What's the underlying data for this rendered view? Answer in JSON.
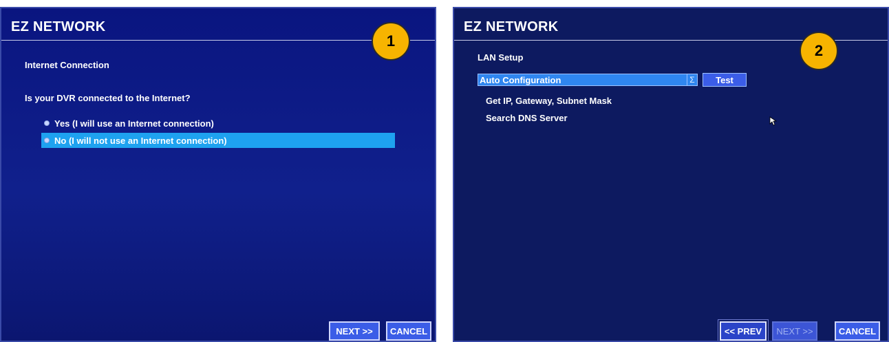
{
  "panel1": {
    "title": "EZ NETWORK",
    "badge": "1",
    "section_label": "Internet Connection",
    "question": "Is your DVR connected to the Internet?",
    "options": [
      {
        "label": "Yes (I will use an Internet connection)",
        "selected": false
      },
      {
        "label": "No (I will not use an Internet connection)",
        "selected": true
      }
    ],
    "next_label": "NEXT >>",
    "cancel_label": "CANCEL"
  },
  "panel2": {
    "title": "EZ NETWORK",
    "badge": "2",
    "section_label": "LAN Setup",
    "dropdown_value": "Auto Configuration",
    "dropdown_arrow": "Σ",
    "test_label": "Test",
    "info_lines": [
      "Get IP, Gateway, Subnet Mask",
      "Search DNS Server"
    ],
    "prev_label": "<< PREV",
    "next_label": "NEXT >>",
    "cancel_label": "CANCEL"
  },
  "colors": {
    "panel_bg": "#0f1a6e",
    "highlight": "#1ea2f0",
    "button": "#3b5de7",
    "badge": "#f7b400"
  }
}
